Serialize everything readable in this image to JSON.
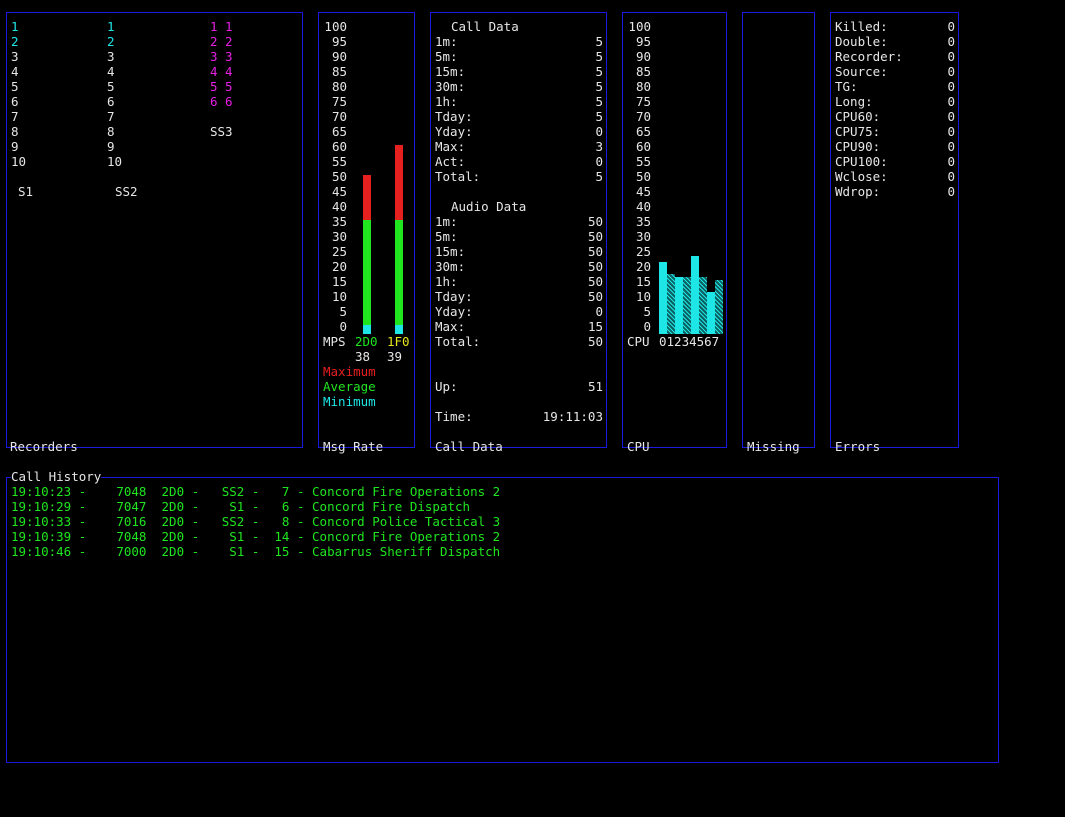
{
  "recorders": {
    "title": "Recorders",
    "col1": [
      "1",
      "2",
      "3",
      "4",
      "5",
      "6",
      "7",
      "8",
      "9",
      "10"
    ],
    "col2": [
      "1",
      "2",
      "3",
      "4",
      "5",
      "6",
      "7",
      "8",
      "9",
      "10"
    ],
    "col3": [
      "1 1",
      "2 2",
      "3 3",
      "4 4",
      "5 5",
      "6 6"
    ],
    "label_s1": "S1",
    "label_ss2": "SS2",
    "label_ss3": "SS3"
  },
  "msg_rate": {
    "title": "Msg Rate",
    "scale": [
      "100",
      "95",
      "90",
      "85",
      "80",
      "75",
      "70",
      "65",
      "60",
      "55",
      "50",
      "45",
      "40",
      "35",
      "30",
      "25",
      "20",
      "15",
      "10",
      "5",
      "0"
    ],
    "mps_label": "MPS",
    "bars": [
      {
        "name": "2D0",
        "value": "38",
        "maximum": 53,
        "average": 38,
        "minimum": 3
      },
      {
        "name": "1F0",
        "value": "39",
        "maximum": 63,
        "average": 38,
        "minimum": 3
      }
    ],
    "legend": {
      "maximum": "Maximum",
      "average": "Average",
      "minimum": "Minimum"
    }
  },
  "call_data": {
    "title": "Call Data",
    "header": "Call Data",
    "rows": [
      {
        "k": "1m:",
        "v": "5"
      },
      {
        "k": "5m:",
        "v": "5"
      },
      {
        "k": "15m:",
        "v": "5"
      },
      {
        "k": "30m:",
        "v": "5"
      },
      {
        "k": "1h:",
        "v": "5"
      },
      {
        "k": "Tday:",
        "v": "5"
      },
      {
        "k": "Yday:",
        "v": "0"
      },
      {
        "k": "Max:",
        "v": "3"
      },
      {
        "k": "Act:",
        "v": "0"
      },
      {
        "k": "Total:",
        "v": "5"
      }
    ],
    "audio_header": "Audio Data",
    "audio_rows": [
      {
        "k": "1m:",
        "v": "50"
      },
      {
        "k": "5m:",
        "v": "50"
      },
      {
        "k": "15m:",
        "v": "50"
      },
      {
        "k": "30m:",
        "v": "50"
      },
      {
        "k": "1h:",
        "v": "50"
      },
      {
        "k": "Tday:",
        "v": "50"
      },
      {
        "k": "Yday:",
        "v": "0"
      },
      {
        "k": "Max:",
        "v": "15"
      },
      {
        "k": "Total:",
        "v": "50"
      }
    ],
    "up_label": "Up:",
    "up_value": "51",
    "time_label": "Time:",
    "time_value": "19:11:03"
  },
  "cpu": {
    "title": "CPU",
    "scale": [
      "100",
      "95",
      "90",
      "85",
      "80",
      "75",
      "70",
      "65",
      "60",
      "55",
      "50",
      "45",
      "40",
      "35",
      "30",
      "25",
      "20",
      "15",
      "10",
      "5",
      "0"
    ],
    "label": "CPU",
    "cores": "01234567",
    "values": [
      24,
      20,
      19,
      19,
      26,
      19,
      14,
      18
    ]
  },
  "missing": {
    "title": "Missing"
  },
  "errors": {
    "title": "Errors",
    "rows": [
      {
        "k": "Killed:",
        "v": "0"
      },
      {
        "k": "Double:",
        "v": "0"
      },
      {
        "k": "Recorder:",
        "v": "0"
      },
      {
        "k": "Source:",
        "v": "0"
      },
      {
        "k": "TG:",
        "v": "0"
      },
      {
        "k": "Long:",
        "v": "0"
      },
      {
        "k": "CPU60:",
        "v": "0"
      },
      {
        "k": "CPU75:",
        "v": "0"
      },
      {
        "k": "CPU90:",
        "v": "0"
      },
      {
        "k": "CPU100:",
        "v": "0"
      },
      {
        "k": "Wclose:",
        "v": "0"
      },
      {
        "k": "Wdrop:",
        "v": "0"
      }
    ]
  },
  "call_history": {
    "title": "Call History",
    "rows": [
      "19:10:23 -    7048  2D0 -   SS2 -   7 - Concord Fire Operations 2",
      "19:10:29 -    7047  2D0 -    S1 -   6 - Concord Fire Dispatch",
      "19:10:33 -    7016  2D0 -   SS2 -   8 - Concord Police Tactical 3",
      "19:10:39 -    7048  2D0 -    S1 -  14 - Concord Fire Operations 2",
      "19:10:46 -    7000  2D0 -    S1 -  15 - Cabarrus Sheriff Dispatch"
    ]
  },
  "colors": {
    "border": "#1a1adc",
    "green": "#1fe61f",
    "cyan": "#1fe6e6",
    "red": "#e61f1f",
    "magenta": "#e61fe6",
    "yellow": "#e6e61f"
  }
}
